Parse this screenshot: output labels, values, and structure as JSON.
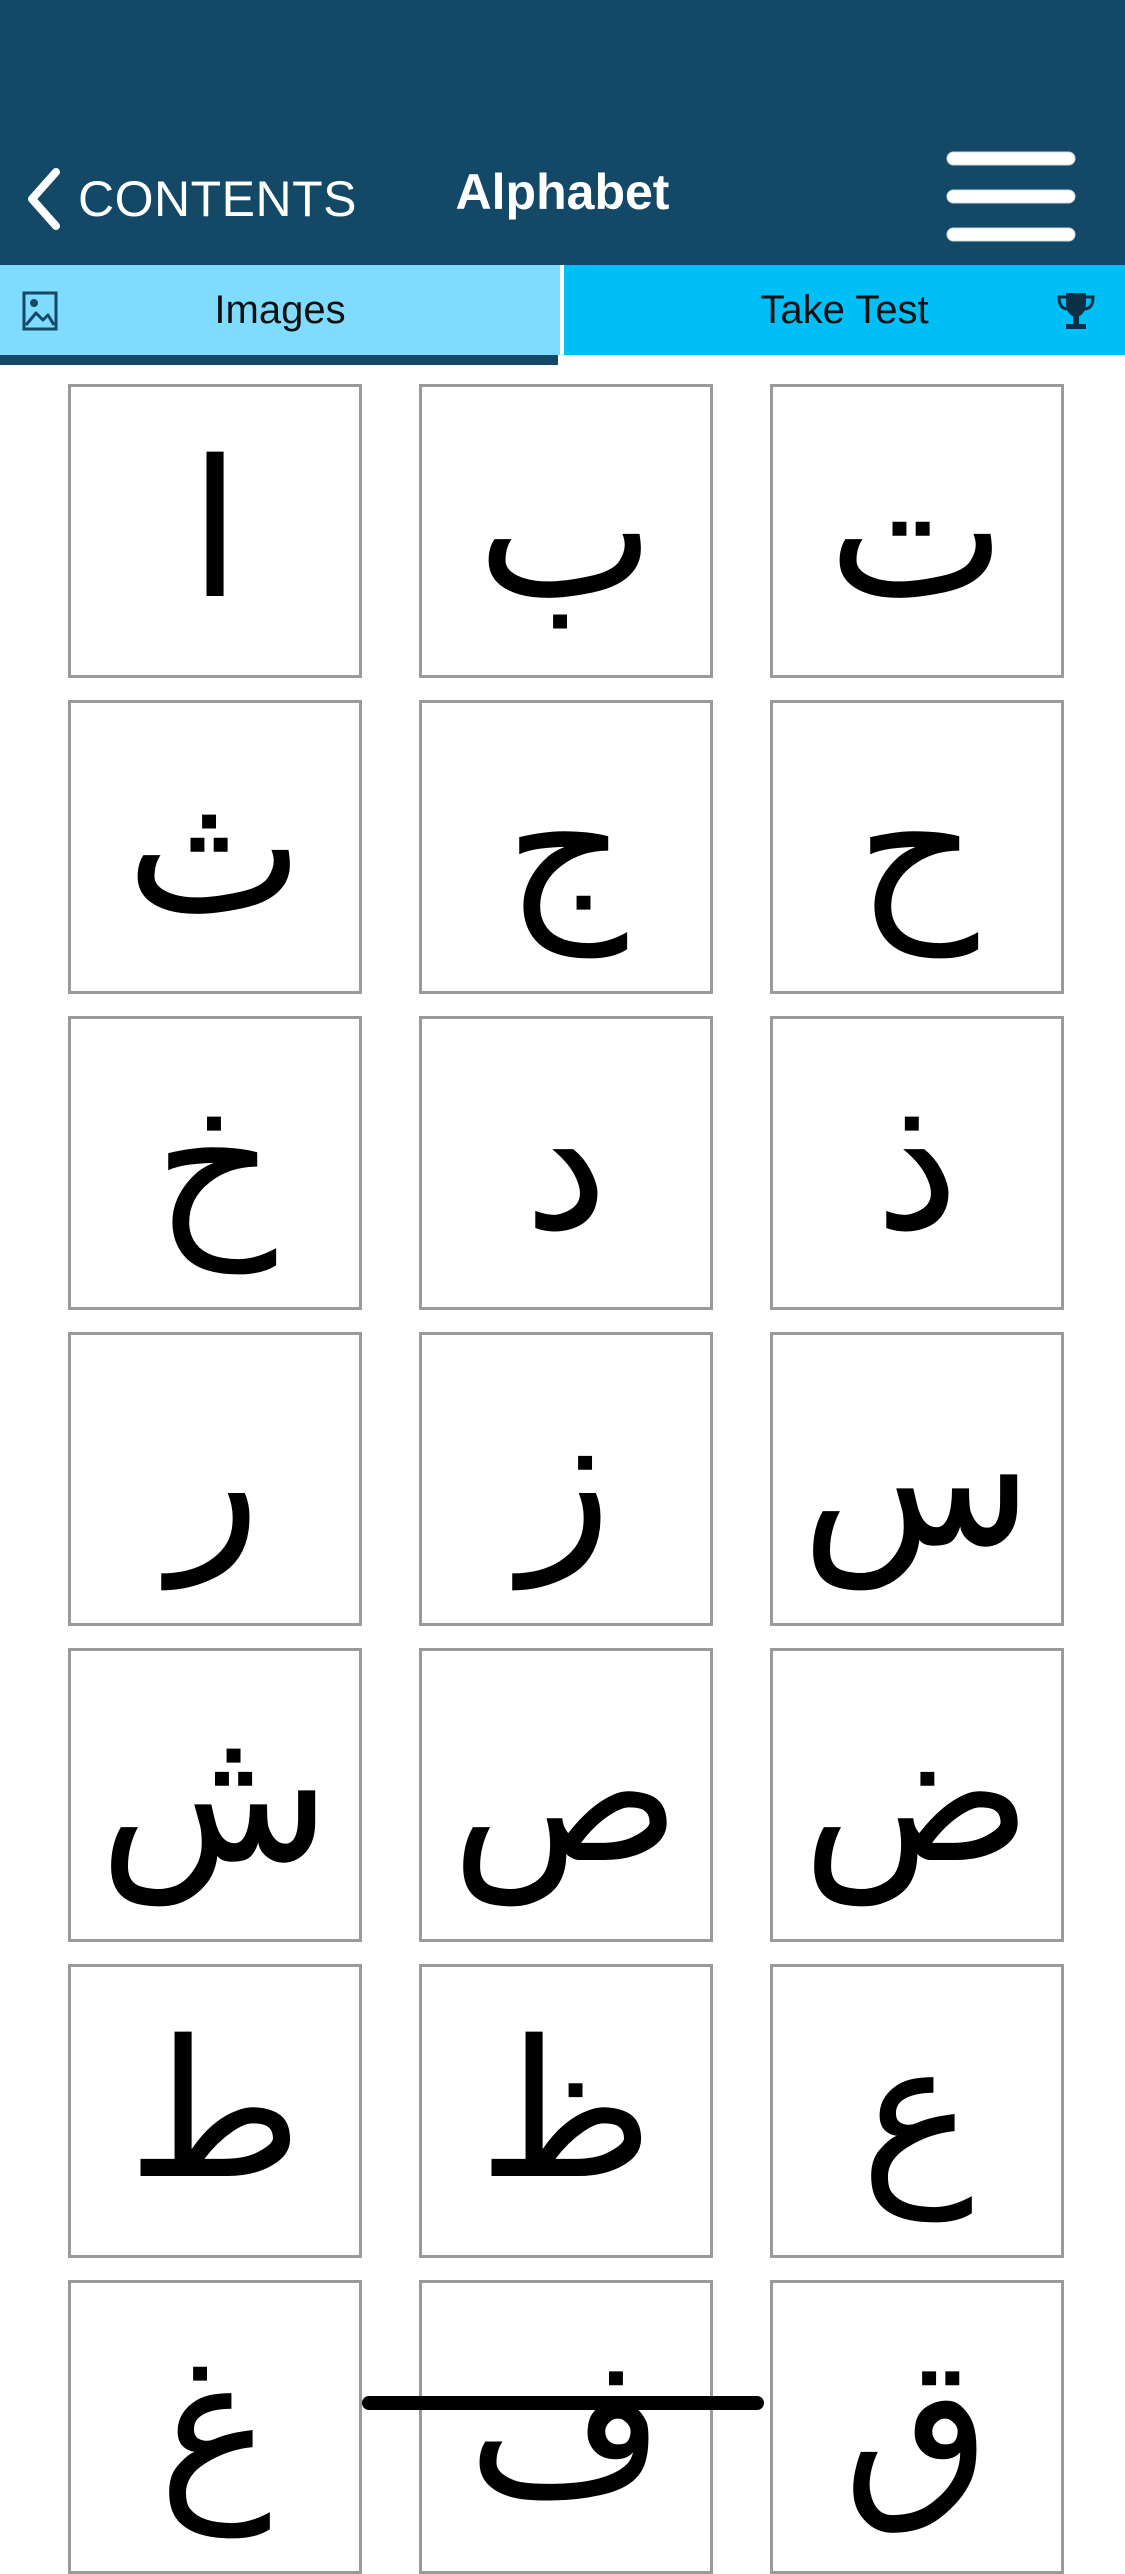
{
  "header": {
    "back_label": "CONTENTS",
    "title": "Alphabet",
    "back_icon": "chevron-left-icon",
    "menu_icon": "hamburger-menu-icon"
  },
  "tabs": [
    {
      "label": "Images",
      "icon": "image-icon",
      "selected": true
    },
    {
      "label": "Take Test",
      "icon": "trophy-icon",
      "selected": false
    }
  ],
  "letters": [
    "ا",
    "ب",
    "ت",
    "ث",
    "ج",
    "ح",
    "خ",
    "د",
    "ذ",
    "ر",
    "ز",
    "س",
    "ش",
    "ص",
    "ض",
    "ط",
    "ظ",
    "ع",
    "غ",
    "ف",
    "ق"
  ],
  "colors": {
    "header_bg": "#134966",
    "tab_selected_bg": "#7fdcff",
    "tab_bg": "#00bff7",
    "cell_border": "#9a9a9a"
  }
}
